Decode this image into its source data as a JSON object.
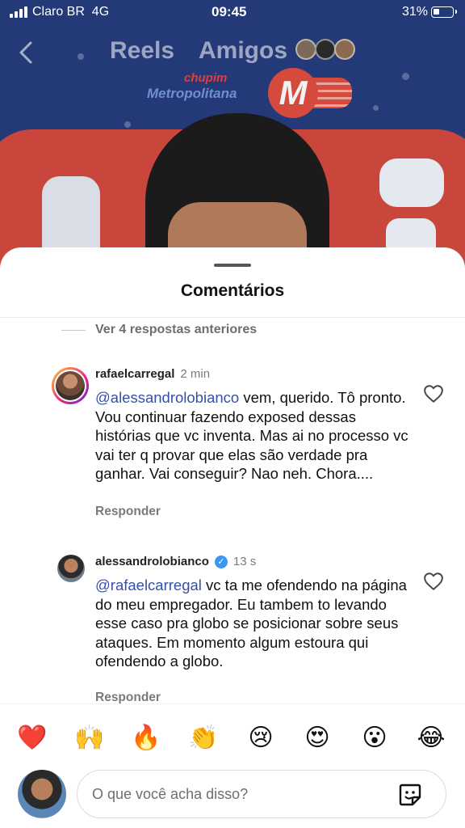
{
  "status_bar": {
    "carrier": "Claro BR",
    "network": "4G",
    "time": "09:45",
    "battery": "31%",
    "battery_level": 0.31
  },
  "nav": {
    "back_icon": "chevron-left-icon",
    "tabs": [
      {
        "label": "Reels"
      },
      {
        "label": "Amigos"
      }
    ]
  },
  "video": {
    "brand_top": "chupim",
    "brand_bottom": "Metropolitana",
    "logo_letter": "M"
  },
  "sheet": {
    "title": "Comentários",
    "view_previous": "Ver 4 respostas anteriores"
  },
  "comments": [
    {
      "username": "rafaelcarregal",
      "time": "2 min",
      "mention": "@alessandrolobianco",
      "text": " vem, querido. Tô pronto. Vou continuar fazendo exposed dessas histórias que vc inventa. Mas ai no processo vc vai ter q provar que elas são verdade pra ganhar. Vai conseguir? Nao neh. Chora....",
      "reply_label": "Responder",
      "verified": false
    },
    {
      "username": "alessandrolobianco",
      "time": "13 s",
      "mention": "@rafaelcarregal",
      "text": " vc ta me ofendendo na página do meu empregador. Eu tambem to levando esse caso pra globo se posicionar sobre seus ataques. Em momento algum estoura qui ofendendo a globo.",
      "reply_label": "Responder",
      "verified": true
    }
  ],
  "reactions": [
    "❤️",
    "🙌",
    "🔥",
    "👏",
    "😢",
    "😍",
    "😮",
    "😂"
  ],
  "composer": {
    "placeholder": "O que você acha disso?",
    "sticker_icon": "sticker-icon"
  },
  "colors": {
    "mention": "#3650a8",
    "verified": "#3897f0",
    "secondary_text": "#7a7a7a"
  }
}
